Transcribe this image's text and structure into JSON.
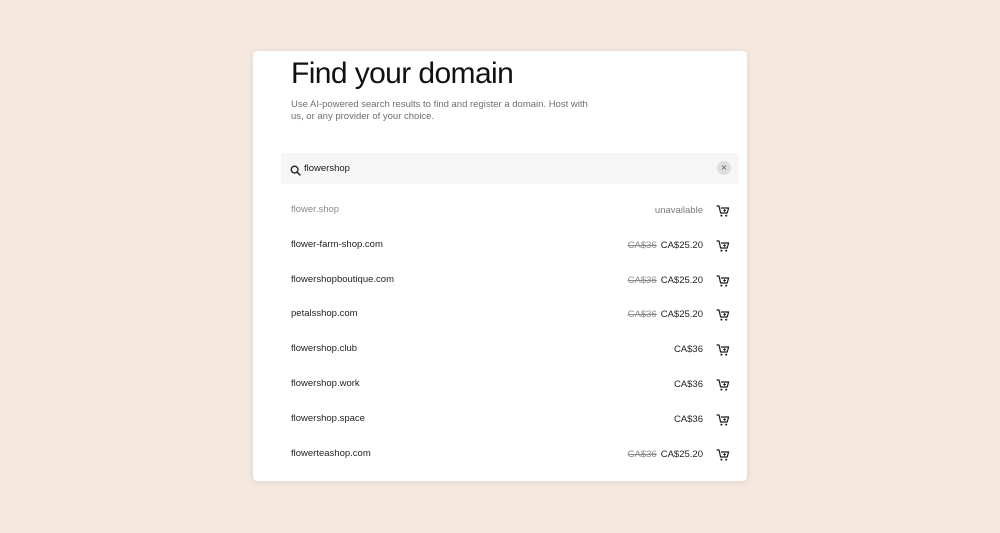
{
  "page": {
    "title": "Find your domain",
    "subtitle": "Use AI-powered search results to find and register a domain. Host with us, or any provider of your choice."
  },
  "search": {
    "value": "flowershop",
    "icon": "search-icon",
    "clear_icon": "close-icon",
    "clear_glyph": "×"
  },
  "colors": {
    "page_background": "#f5e8df",
    "card_background": "#ffffff",
    "muted_text": "#8a8a8a"
  },
  "results": [
    {
      "domain": "flower.shop",
      "status": "unavailable",
      "old_price": "",
      "price": ""
    },
    {
      "domain": "flower-farm-shop.com",
      "status": "",
      "old_price": "CA$36",
      "price": "CA$25.20"
    },
    {
      "domain": "flowershopboutique.com",
      "status": "",
      "old_price": "CA$36",
      "price": "CA$25.20"
    },
    {
      "domain": "petalsshop.com",
      "status": "",
      "old_price": "CA$36",
      "price": "CA$25.20"
    },
    {
      "domain": "flowershop.club",
      "status": "",
      "old_price": "",
      "price": "CA$36"
    },
    {
      "domain": "flowershop.work",
      "status": "",
      "old_price": "",
      "price": "CA$36"
    },
    {
      "domain": "flowershop.space",
      "status": "",
      "old_price": "",
      "price": "CA$36"
    },
    {
      "domain": "flowerteashop.com",
      "status": "",
      "old_price": "CA$36",
      "price": "CA$25.20"
    }
  ]
}
